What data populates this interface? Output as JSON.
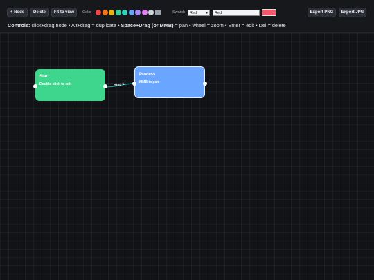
{
  "toolbar": {
    "add_node_label": "+ Node",
    "delete_label": "Delete",
    "fit_label": "Fit to view",
    "color_label": "Color",
    "swatch_label": "Swatch",
    "swatch_select_value": "Red",
    "swatch_name_value": "Red",
    "export_png_label": "Export PNG",
    "export_jpg_label": "Export JPG",
    "palette": [
      "#ef4444",
      "#f97316",
      "#eab308",
      "#34d399",
      "#2dd4bf",
      "#60a5fa",
      "#a78bfa",
      "#e879f9",
      "#d1d5db",
      "#9ca3af"
    ],
    "current_color": "#f05a6a"
  },
  "controls": {
    "prefix": "Controls:",
    "part1": " click+drag node • Alt+drag = duplicate • ",
    "bold": "Space+Drag (or MMB)",
    "part2": " = pan • wheel = zoom • Enter = edit • Del = delete"
  },
  "nodes": [
    {
      "title": "Start",
      "subtitle": "Double-click to edit",
      "color": "#3dd68c"
    },
    {
      "title": "Process",
      "subtitle": "MMB to pan",
      "color": "#6aa6ff",
      "selected": true
    }
  ],
  "edge": {
    "label": "step 1",
    "color": "#1aa3a3"
  }
}
